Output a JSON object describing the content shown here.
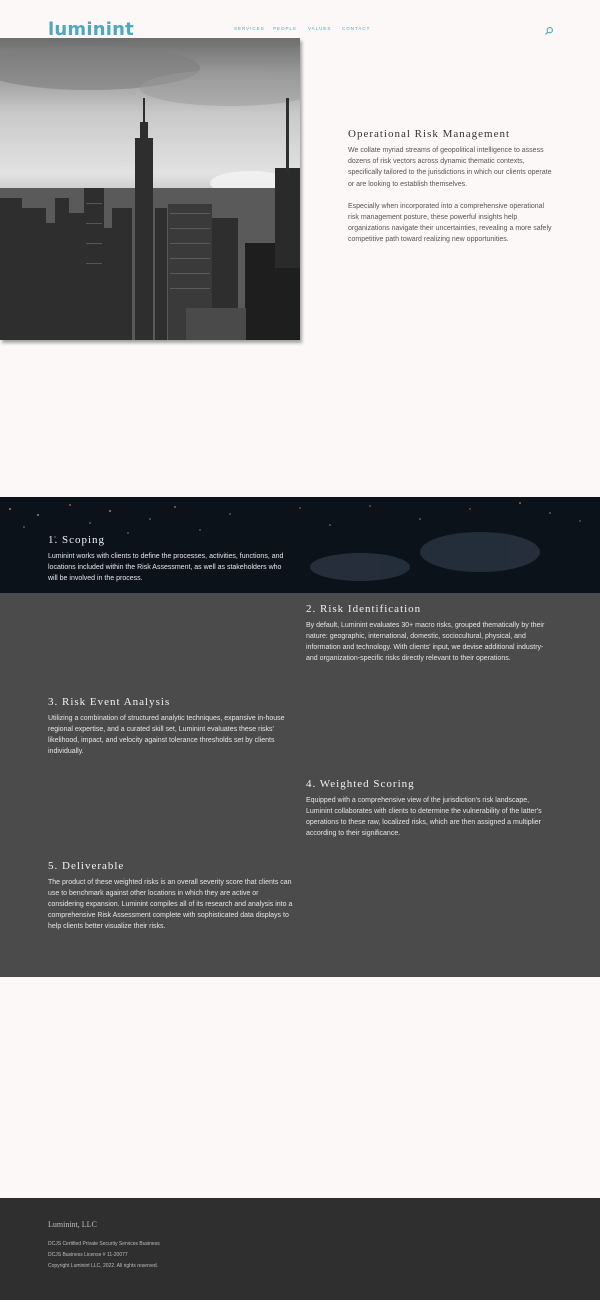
{
  "header": {
    "logo": "luminint",
    "nav": [
      "SERVICES",
      "PEOPLE",
      "VALUES",
      "CONTACT"
    ]
  },
  "intro": {
    "title": "Operational Risk Management",
    "paragraphs": [
      "We collate myriad streams of geopolitical intelligence to assess dozens of risk vectors across dynamic thematic contexts, specifically tailored to the jurisdictions in which our clients operate or are looking to establish themselves.",
      "Especially when incorporated into a comprehensive operational risk management posture, these powerful insights help organizations navigate their uncertainties, revealing a more safely competitive path toward realizing new opportunities."
    ]
  },
  "steps": [
    {
      "title": "1. Scoping",
      "text": "Luminint works with clients to define the processes, activities, functions, and locations included within the Risk Assessment, as well as stakeholders who will be involved in the process."
    },
    {
      "title": "2. Risk Identification",
      "text": "By default, Luminint evaluates 30+ macro risks, grouped thematically by their nature: geographic, international, domestic, sociocultural, physical, and information and technology. With clients' input, we devise additional industry- and organization-specific risks directly relevant to their operations."
    },
    {
      "title": "3. Risk Event Analysis",
      "text": "Utilizing a combination of structured analytic techniques, expansive in-house regional expertise, and a curated skill set, Luminint evaluates these risks' likelihood, impact, and velocity against tolerance thresholds set by clients individually."
    },
    {
      "title": "4. Weighted Scoring",
      "text": "Equipped with a comprehensive view of the jurisdiction's risk landscape, Luminint collaborates with clients to determine the vulnerability of the latter's operations to these raw, localized risks, which are then assigned a multiplier according to their significance."
    },
    {
      "title": "5. Deliverable",
      "text": "The product of these weighted risks is an overall severity score that clients can use to benchmark against other locations in which they are active or considering expansion. Luminint compiles all of its research and analysis into a comprehensive Risk Assessment complete with sophisticated data displays to help clients better visualize their risks."
    }
  ],
  "footer": {
    "company": "Luminint, LLC",
    "lines": [
      "DCJS Certified Private Security Services Business",
      "DCJS Business License # 11-20077",
      "Copyright Luminint LLC, 2022.  All rights reserved."
    ]
  },
  "icons": {
    "search": "search-icon"
  },
  "colors": {
    "accent": "#4fa8c2",
    "band_dark": "#0c121a",
    "band_grey": "#4b4b4b",
    "footer": "#2f2f2f",
    "page": "#fcf8f7"
  }
}
